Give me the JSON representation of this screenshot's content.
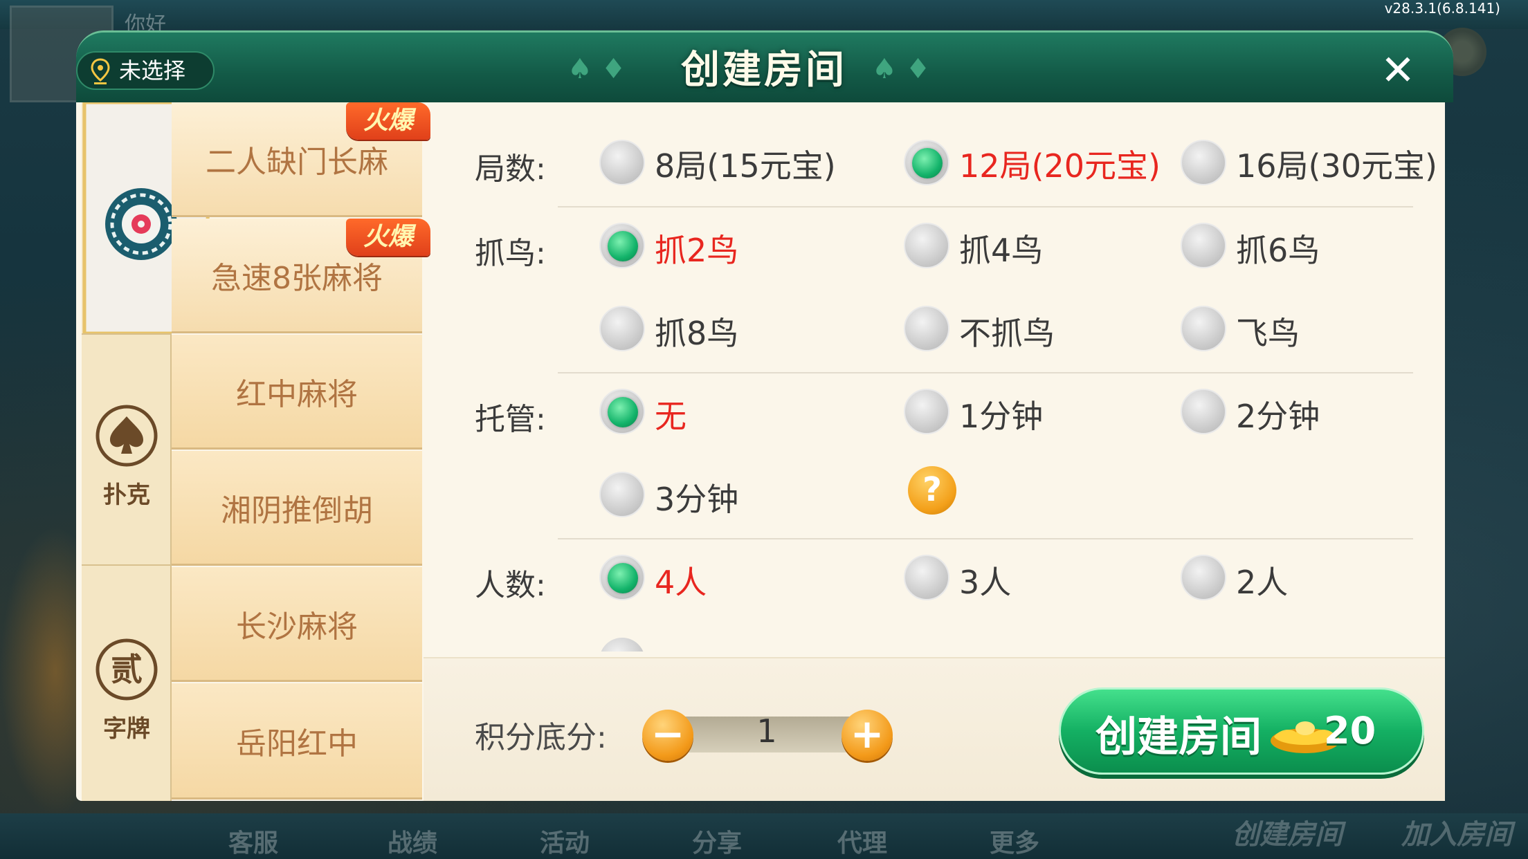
{
  "version": "v28.3.1(6.8.141)",
  "background": {
    "greeting": "你好",
    "bottom_nav": [
      "客服",
      "战绩",
      "活动",
      "分享",
      "代理",
      "更多"
    ],
    "bottom_actions": [
      "创建房间",
      "加入房间"
    ]
  },
  "dialog": {
    "title": "创建房间",
    "location": "未选择",
    "close_symbol": "✕"
  },
  "categories": [
    {
      "label": "",
      "icon": "mahjong-icon",
      "active": true
    },
    {
      "label": "扑克",
      "icon": "spade-icon",
      "active": false
    },
    {
      "label": "字牌",
      "icon": "er-icon",
      "active": false
    }
  ],
  "games": [
    {
      "name": "二人缺门长麻",
      "hot": "火爆"
    },
    {
      "name": "急速8张麻将",
      "hot": "火爆"
    },
    {
      "name": "红中麻将",
      "hot": ""
    },
    {
      "name": "湘阴推倒胡",
      "hot": ""
    },
    {
      "name": "长沙麻将",
      "hot": ""
    },
    {
      "name": "岳阳红中",
      "hot": ""
    }
  ],
  "options": {
    "rounds": {
      "label": "局数:",
      "choices": [
        "8局(15元宝)",
        "12局(20元宝)",
        "16局(30元宝)"
      ],
      "selected": 1
    },
    "birds": {
      "label": "抓鸟:",
      "choices": [
        "抓2鸟",
        "抓4鸟",
        "抓6鸟",
        "抓8鸟",
        "不抓鸟",
        "飞鸟"
      ],
      "selected": 0
    },
    "trustee": {
      "label": "托管:",
      "choices": [
        "无",
        "1分钟",
        "2分钟",
        "3分钟"
      ],
      "selected": 0,
      "help": "?"
    },
    "players": {
      "label": "人数:",
      "choices": [
        "4人",
        "3人",
        "2人"
      ],
      "selected": 0
    }
  },
  "footer": {
    "score_label": "积分底分:",
    "score_value": "1",
    "minus": "−",
    "plus": "+",
    "create_label": "创建房间",
    "cost": "20"
  },
  "colors": {
    "header_green": "#135a47",
    "selected_text": "#e8261f",
    "radio_on": "#13b36a",
    "orange": "#f39a1a"
  }
}
